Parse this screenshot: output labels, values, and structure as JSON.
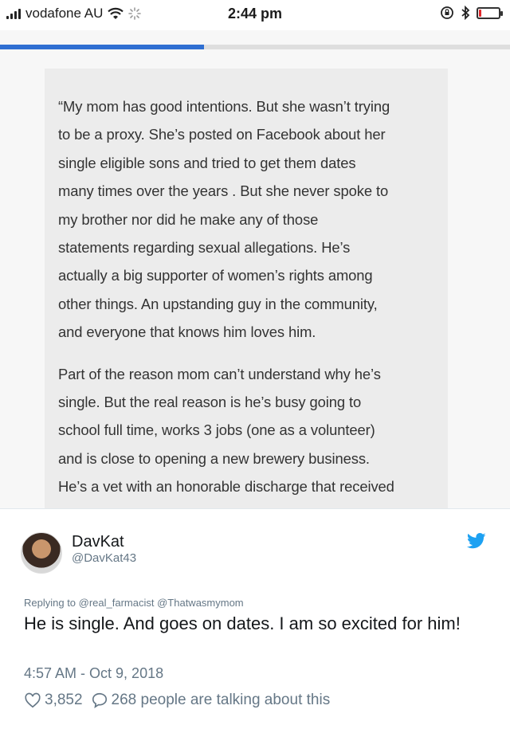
{
  "status_bar": {
    "carrier": "vodafone AU",
    "time": "2:44 pm",
    "battery_level_percent": 10,
    "battery_color": "#e0282c"
  },
  "page_load_progress_percent": 40,
  "quote": {
    "paragraphs": [
      "“My mom has good intentions. But she wasn’t trying\nto be a proxy. She’s posted on Facebook about her\nsingle eligible sons and tried to get them dates\nmany times over the years . But she never spoke to\nmy brother nor did he make any of those\nstatements regarding sexual allegations. He’s\nactually a big supporter of women’s rights among\nother things. An upstanding guy in the community,\nand everyone that knows him loves him.",
      "Part of the reason mom can’t understand why he’s\nsingle. But the real reason is he’s busy going to\nschool full time, works 3 jobs (one as a volunteer)\nand is close to opening a new brewery business.\nHe’s a vet with an honorable discharge that received"
    ]
  },
  "tweet": {
    "display_name": "DavKat",
    "handle": "@DavKat43",
    "replying_to": "Replying to @real_farmacist @Thatwasmymom",
    "text": "He is single. And goes on dates. I am so excited for him!",
    "timestamp": "4:57 AM - Oct 9, 2018",
    "likes": "3,852",
    "replies_label": "268 people are talking about this",
    "brand_color": "#1da1f2"
  }
}
